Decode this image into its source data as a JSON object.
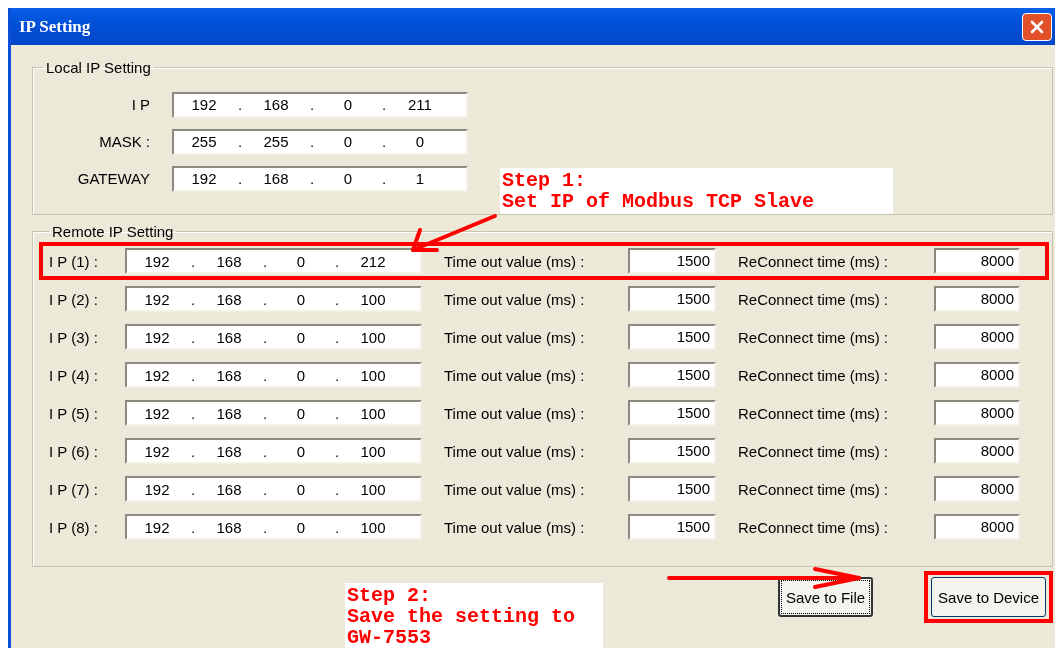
{
  "window": {
    "title": "IP Setting"
  },
  "local_group": {
    "title": "Local IP Setting",
    "fields": [
      {
        "label": "I P",
        "segments": [
          "192",
          ".",
          "168",
          ".",
          "0",
          ".",
          "211"
        ]
      },
      {
        "label": "MASK :",
        "segments": [
          "255",
          ".",
          "255",
          ".",
          "0",
          ".",
          "0"
        ]
      },
      {
        "label": "GATEWAY",
        "segments": [
          "192",
          ".",
          "168",
          ".",
          "0",
          ".",
          "1"
        ]
      }
    ]
  },
  "remote_group": {
    "title": "Remote IP Setting",
    "rows": [
      {
        "label": "I P (1) :",
        "segments": [
          "192",
          ".",
          "168",
          ".",
          "0",
          ".",
          "212"
        ],
        "timeout_label": "Time out value (ms) :",
        "timeout": "1500",
        "reconnect_label": "ReConnect time (ms) :",
        "reconnect": "8000",
        "highlighted": true
      },
      {
        "label": "I P (2) :",
        "segments": [
          "192",
          ".",
          "168",
          ".",
          "0",
          ".",
          "100"
        ],
        "timeout_label": "Time out value (ms) :",
        "timeout": "1500",
        "reconnect_label": "ReConnect time (ms) :",
        "reconnect": "8000",
        "highlighted": false
      },
      {
        "label": "I P (3) :",
        "segments": [
          "192",
          ".",
          "168",
          ".",
          "0",
          ".",
          "100"
        ],
        "timeout_label": "Time out value (ms) :",
        "timeout": "1500",
        "reconnect_label": "ReConnect time (ms) :",
        "reconnect": "8000",
        "highlighted": false
      },
      {
        "label": "I P (4) :",
        "segments": [
          "192",
          ".",
          "168",
          ".",
          "0",
          ".",
          "100"
        ],
        "timeout_label": "Time out value (ms) :",
        "timeout": "1500",
        "reconnect_label": "ReConnect time (ms) :",
        "reconnect": "8000",
        "highlighted": false
      },
      {
        "label": "I P (5) :",
        "segments": [
          "192",
          ".",
          "168",
          ".",
          "0",
          ".",
          "100"
        ],
        "timeout_label": "Time out value (ms) :",
        "timeout": "1500",
        "reconnect_label": "ReConnect time (ms) :",
        "reconnect": "8000",
        "highlighted": false
      },
      {
        "label": "I P (6) :",
        "segments": [
          "192",
          ".",
          "168",
          ".",
          "0",
          ".",
          "100"
        ],
        "timeout_label": "Time out value (ms) :",
        "timeout": "1500",
        "reconnect_label": "ReConnect time (ms) :",
        "reconnect": "8000",
        "highlighted": false
      },
      {
        "label": "I P (7) :",
        "segments": [
          "192",
          ".",
          "168",
          ".",
          "0",
          ".",
          "100"
        ],
        "timeout_label": "Time out value (ms) :",
        "timeout": "1500",
        "reconnect_label": "ReConnect time (ms) :",
        "reconnect": "8000",
        "highlighted": false
      },
      {
        "label": "I P (8) :",
        "segments": [
          "192",
          ".",
          "168",
          ".",
          "0",
          ".",
          "100"
        ],
        "timeout_label": "Time out value (ms) :",
        "timeout": "1500",
        "reconnect_label": "ReConnect time (ms) :",
        "reconnect": "8000",
        "highlighted": false
      }
    ]
  },
  "buttons": [
    {
      "label": "Save to File",
      "focused": true,
      "highlighted": false
    },
    {
      "label": "Save to Device",
      "focused": false,
      "highlighted": true
    }
  ],
  "annotations": [
    {
      "kind": "step1",
      "lines": [
        "Step 1:",
        "Set IP of Modbus TCP Slave"
      ]
    },
    {
      "kind": "step2",
      "lines": [
        "Step 2:",
        "Save the setting to",
        "GW-7553"
      ]
    }
  ]
}
